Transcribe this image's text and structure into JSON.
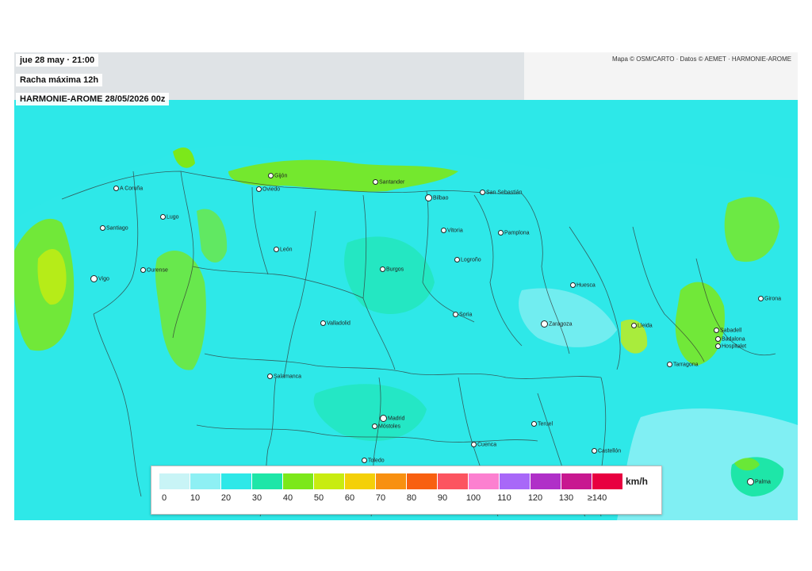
{
  "header": {
    "datetime": "jue 28 may · 21:00",
    "variable": "Racha máxima 12h",
    "model_run": "HARMONIE-AROME 28/05/2026 00z"
  },
  "attribution": "Mapa © OSM/CARTO · Datos © AEMET · HARMONIE-AROME",
  "legend": {
    "unit": "km/h",
    "classes": [
      {
        "label": "0",
        "color": "#c8f4f6"
      },
      {
        "label": "10",
        "color": "#8ef0f4"
      },
      {
        "label": "20",
        "color": "#2ee8e8"
      },
      {
        "label": "30",
        "color": "#1ee6a8"
      },
      {
        "label": "40",
        "color": "#7ce81a"
      },
      {
        "label": "50",
        "color": "#c8ec10"
      },
      {
        "label": "60",
        "color": "#f4d008"
      },
      {
        "label": "70",
        "color": "#f89010"
      },
      {
        "label": "80",
        "color": "#f86010"
      },
      {
        "label": "90",
        "color": "#fc5460"
      },
      {
        "label": "100",
        "color": "#fc80d0"
      },
      {
        "label": "110",
        "color": "#a868f8"
      },
      {
        "label": "120",
        "color": "#b030c8"
      },
      {
        "label": "130",
        "color": "#c81890"
      },
      {
        "label": "≥140",
        "color": "#e80040"
      }
    ]
  },
  "cities": [
    {
      "name": "A Coruña"
    },
    {
      "name": "Gijón"
    },
    {
      "name": "Oviedo"
    },
    {
      "name": "Santander"
    },
    {
      "name": "Bilbao"
    },
    {
      "name": "San Sebastián"
    },
    {
      "name": "Lugo"
    },
    {
      "name": "Santiago"
    },
    {
      "name": "Vitoria"
    },
    {
      "name": "Pamplona"
    },
    {
      "name": "León"
    },
    {
      "name": "Logroño"
    },
    {
      "name": "Ourense"
    },
    {
      "name": "Vigo"
    },
    {
      "name": "Burgos"
    },
    {
      "name": "Huesca"
    },
    {
      "name": "Girona"
    },
    {
      "name": "Soria"
    },
    {
      "name": "Valladolid"
    },
    {
      "name": "Zaragoza"
    },
    {
      "name": "Lleida"
    },
    {
      "name": "Sabadell"
    },
    {
      "name": "Badalona"
    },
    {
      "name": "Hospitalet"
    },
    {
      "name": "Tarragona"
    },
    {
      "name": "Salamanca"
    },
    {
      "name": "Madrid"
    },
    {
      "name": "Móstoles"
    },
    {
      "name": "Teruel"
    },
    {
      "name": "Cuenca"
    },
    {
      "name": "Castellón"
    },
    {
      "name": "Toledo"
    },
    {
      "name": "Palma"
    }
  ],
  "colors": {
    "sea_background": "#a8eef4",
    "land_dominant": "#2ee8e8",
    "basemap_gray": "#dfe3e6",
    "border_line": "#333333"
  }
}
